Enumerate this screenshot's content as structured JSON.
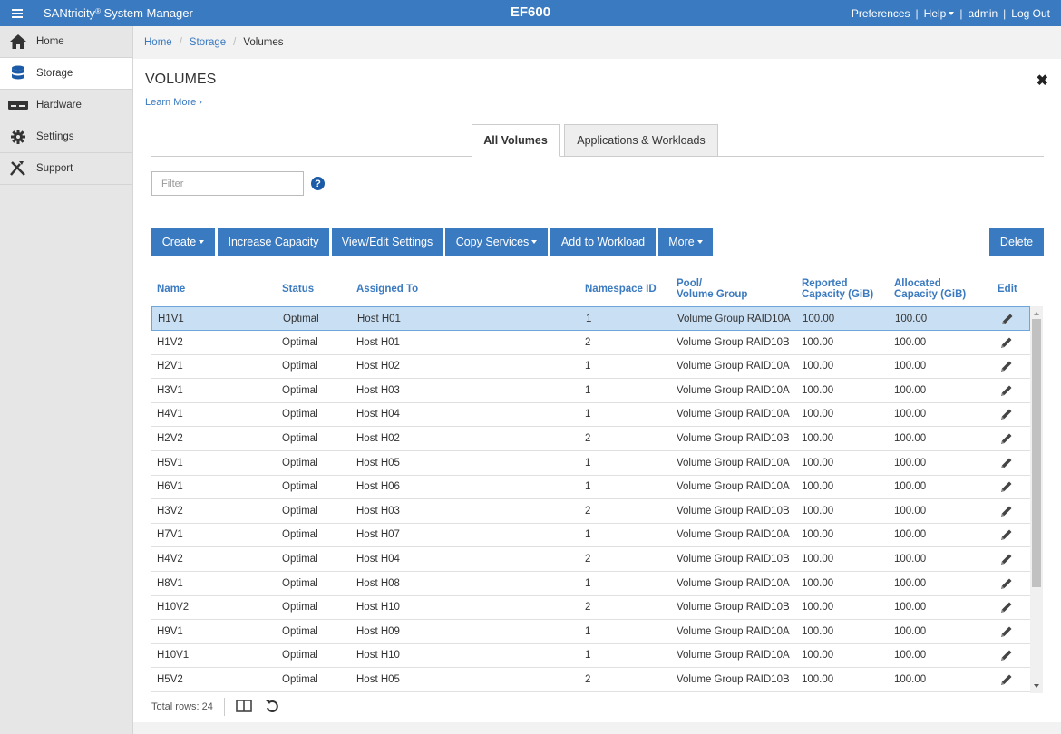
{
  "header": {
    "app_name_pre": "SANtricity",
    "app_name_reg": "®",
    "app_name_post": " System Manager",
    "system_name": "EF600",
    "links": {
      "preferences": "Preferences",
      "help": "Help",
      "user": "admin",
      "logout": "Log Out",
      "separator": "|"
    }
  },
  "sidebar": {
    "items": [
      {
        "label": "Home",
        "icon": "home-icon"
      },
      {
        "label": "Storage",
        "icon": "storage-icon"
      },
      {
        "label": "Hardware",
        "icon": "hardware-icon"
      },
      {
        "label": "Settings",
        "icon": "gear-icon"
      },
      {
        "label": "Support",
        "icon": "tools-icon"
      }
    ],
    "active": "Storage"
  },
  "breadcrumb": {
    "home": "Home",
    "storage": "Storage",
    "current": "Volumes",
    "sep": "/"
  },
  "page": {
    "title": "VOLUMES",
    "learn_more": "Learn More ›"
  },
  "tabs": {
    "all_volumes": "All Volumes",
    "apps_workloads": "Applications & Workloads"
  },
  "filter": {
    "placeholder": "Filter",
    "value": "",
    "help": "?"
  },
  "toolbar": {
    "create": "Create",
    "increase_capacity": "Increase Capacity",
    "view_edit": "View/Edit Settings",
    "copy_services": "Copy Services",
    "add_workload": "Add to Workload",
    "more": "More",
    "delete": "Delete"
  },
  "table": {
    "columns": {
      "name": "Name",
      "status": "Status",
      "assigned": "Assigned To",
      "nsid": "Namespace ID",
      "pool_1": "Pool/",
      "pool_2": "Volume Group",
      "reported_1": "Reported",
      "reported_2": "Capacity (GiB)",
      "allocated_1": "Allocated",
      "allocated_2": "Capacity (GiB)",
      "edit": "Edit"
    },
    "rows": [
      {
        "name": "H1V1",
        "status": "Optimal",
        "assigned": "Host H01",
        "nsid": "1",
        "pool": "Volume Group RAID10A",
        "reported": "100.00",
        "allocated": "100.00"
      },
      {
        "name": "H1V2",
        "status": "Optimal",
        "assigned": "Host H01",
        "nsid": "2",
        "pool": "Volume Group RAID10B",
        "reported": "100.00",
        "allocated": "100.00"
      },
      {
        "name": "H2V1",
        "status": "Optimal",
        "assigned": "Host H02",
        "nsid": "1",
        "pool": "Volume Group RAID10A",
        "reported": "100.00",
        "allocated": "100.00"
      },
      {
        "name": "H3V1",
        "status": "Optimal",
        "assigned": "Host H03",
        "nsid": "1",
        "pool": "Volume Group RAID10A",
        "reported": "100.00",
        "allocated": "100.00"
      },
      {
        "name": "H4V1",
        "status": "Optimal",
        "assigned": "Host H04",
        "nsid": "1",
        "pool": "Volume Group RAID10A",
        "reported": "100.00",
        "allocated": "100.00"
      },
      {
        "name": "H2V2",
        "status": "Optimal",
        "assigned": "Host H02",
        "nsid": "2",
        "pool": "Volume Group RAID10B",
        "reported": "100.00",
        "allocated": "100.00"
      },
      {
        "name": "H5V1",
        "status": "Optimal",
        "assigned": "Host H05",
        "nsid": "1",
        "pool": "Volume Group RAID10A",
        "reported": "100.00",
        "allocated": "100.00"
      },
      {
        "name": "H6V1",
        "status": "Optimal",
        "assigned": "Host H06",
        "nsid": "1",
        "pool": "Volume Group RAID10A",
        "reported": "100.00",
        "allocated": "100.00"
      },
      {
        "name": "H3V2",
        "status": "Optimal",
        "assigned": "Host H03",
        "nsid": "2",
        "pool": "Volume Group RAID10B",
        "reported": "100.00",
        "allocated": "100.00"
      },
      {
        "name": "H7V1",
        "status": "Optimal",
        "assigned": "Host H07",
        "nsid": "1",
        "pool": "Volume Group RAID10A",
        "reported": "100.00",
        "allocated": "100.00"
      },
      {
        "name": "H4V2",
        "status": "Optimal",
        "assigned": "Host H04",
        "nsid": "2",
        "pool": "Volume Group RAID10B",
        "reported": "100.00",
        "allocated": "100.00"
      },
      {
        "name": "H8V1",
        "status": "Optimal",
        "assigned": "Host H08",
        "nsid": "1",
        "pool": "Volume Group RAID10A",
        "reported": "100.00",
        "allocated": "100.00"
      },
      {
        "name": "H10V2",
        "status": "Optimal",
        "assigned": "Host H10",
        "nsid": "2",
        "pool": "Volume Group RAID10B",
        "reported": "100.00",
        "allocated": "100.00"
      },
      {
        "name": "H9V1",
        "status": "Optimal",
        "assigned": "Host H09",
        "nsid": "1",
        "pool": "Volume Group RAID10A",
        "reported": "100.00",
        "allocated": "100.00"
      },
      {
        "name": "H10V1",
        "status": "Optimal",
        "assigned": "Host H10",
        "nsid": "1",
        "pool": "Volume Group RAID10A",
        "reported": "100.00",
        "allocated": "100.00"
      },
      {
        "name": "H5V2",
        "status": "Optimal",
        "assigned": "Host H05",
        "nsid": "2",
        "pool": "Volume Group RAID10B",
        "reported": "100.00",
        "allocated": "100.00"
      }
    ],
    "selected_row": 0
  },
  "footer": {
    "total_rows": "Total rows: 24"
  },
  "colors": {
    "accent": "#3a7ac0",
    "selected_row": "#c9e0f4",
    "sidebar_bg": "#e6e6e6"
  }
}
